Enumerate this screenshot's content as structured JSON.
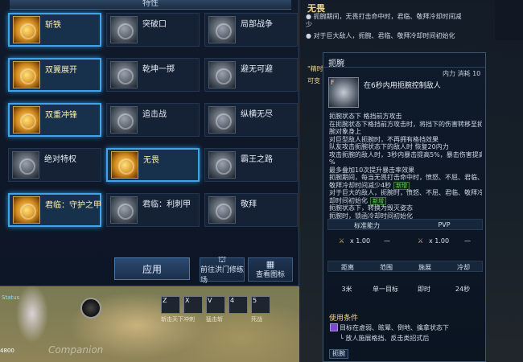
{
  "panel": {
    "title": "特性",
    "rows": [
      [
        {
          "name": "斩铁",
          "icon": "gold",
          "active": true
        },
        {
          "name": "突破口",
          "icon": "gray",
          "active": false
        },
        {
          "name": "局部战争",
          "icon": "gray",
          "active": false
        }
      ],
      [
        {
          "name": "双翼展开",
          "icon": "gold",
          "active": true
        },
        {
          "name": "乾坤一掷",
          "icon": "gray",
          "active": false
        },
        {
          "name": "避无可避",
          "icon": "gray",
          "active": false
        }
      ],
      [
        {
          "name": "双重冲锋",
          "icon": "gold",
          "active": true
        },
        {
          "name": "追击战",
          "icon": "gray",
          "active": false
        },
        {
          "name": "纵横无尽",
          "icon": "gray",
          "active": false
        }
      ],
      [
        {
          "name": "绝对特权",
          "icon": "gray",
          "active": false
        },
        {
          "name": "无畏",
          "icon": "gold",
          "active": true
        },
        {
          "name": "霸王之路",
          "icon": "gray",
          "active": false
        }
      ],
      [
        {
          "name": "君临：守护之甲",
          "icon": "gold",
          "active": true
        },
        {
          "name": "君临：利刺甲",
          "icon": "gray",
          "active": false
        },
        {
          "name": "敬拜",
          "icon": "gray",
          "active": false
        }
      ]
    ],
    "apply_label": "应用",
    "training_label": "前往洪门修练场",
    "view_icons_label": "查看图标"
  },
  "desc": {
    "title": "无畏",
    "line1": "● 扼腕期间，无畏打击命中时，君临、敬拜冷却时间减少",
    "line2": "● 对于巨大敌人，扼腕、君临、敬拜冷却时间初始化",
    "pct": "\"精时",
    "cur": "可变"
  },
  "tooltip": {
    "name": "扼腕",
    "cost": "内力 消耗 10",
    "icon_letter": "F",
    "summary": "在6秒内用扼腕控制敌人",
    "lines": [
      "扼腕状态下 格挡前方攻击",
      "在扼腕状态下格挡前方攻击时，将挡下的伤害转移至扼",
      "腕对象身上",
      "对巨型敌人扼腕时，不再拥有格挡效果",
      "队友攻击扼腕状态下的敌人时 恢复20内力",
      "攻击扼腕的敌人时，3秒内暴击提高5%，暴击伤害提高1",
      "%",
      "最多叠加10次提升暴击率效果"
    ],
    "green_lines": [
      "扼腕期间，每当无畏打击命中时，愤怒、不屈、君临、",
      "敬拜冷却时间减少4秒",
      "对于巨大的敌人，扼腕时，愤怒、不屈、君临、敬拜冷",
      "却时间初始化"
    ],
    "new_tag": "新增",
    "tail_lines": [
      "扼腕状态下，转换为毁灭姿态",
      "扼腕时，锁函冷却时间初始化"
    ],
    "table_head": {
      "standard": "标准能力",
      "pvp": "PVP"
    },
    "multiplier_a": "x 1.00",
    "multiplier_b": "x 1.00",
    "stat_headers": [
      "距离",
      "范围",
      "施展",
      "冷却"
    ],
    "stat_values": [
      "3米",
      "单一目标",
      "即时",
      "24秒"
    ],
    "conditions_title": "使用条件",
    "conditions": [
      "目标在虚弱、眩晕、倒地、擒拿状态下",
      "└ 放人施展格挡、反击类招式后"
    ],
    "footer_button": "扼腕"
  },
  "hotbar": {
    "keys": [
      "Z",
      "X",
      "V",
      "4",
      "5"
    ],
    "labels": [
      "斩击天下",
      "冲刺",
      "猛击斩",
      "",
      "死战"
    ]
  },
  "left": {
    "badge": "Status",
    "stat": "4800"
  },
  "watermark": "Companion"
}
